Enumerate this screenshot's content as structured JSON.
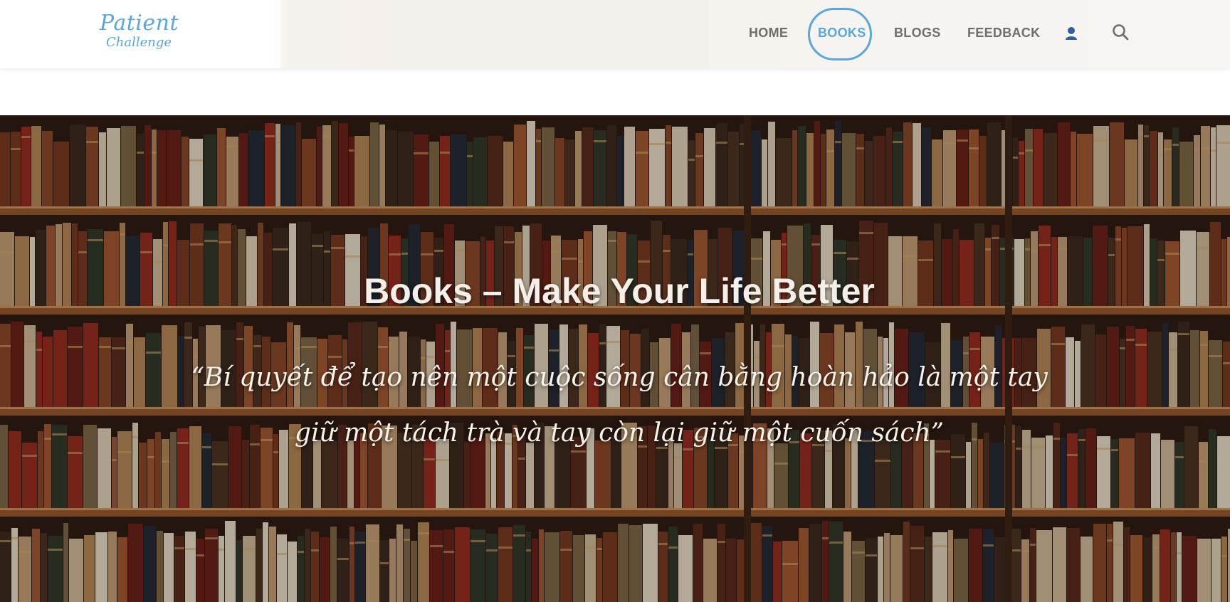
{
  "brand": {
    "line1": "Patient",
    "line2": "Challenge",
    "color": "#5aa6de"
  },
  "nav": {
    "items": [
      {
        "label": "HOME",
        "active": false
      },
      {
        "label": "BOOKS",
        "active": true
      },
      {
        "label": "BLOGS",
        "active": false
      },
      {
        "label": "FEEDBACK",
        "active": false
      }
    ],
    "user_icon": "user-icon",
    "search_icon": "search-icon"
  },
  "hero": {
    "title": "Books – Make Your Life Better",
    "quote": "“Bí quyết để tạo nên một cuộc sống cân bằng hoàn hảo là một tay giữ một tách trà và tay còn lại giữ một cuốn sách”",
    "background": "bookshelf-image"
  },
  "colors": {
    "accent": "#5aa6de",
    "nav_text": "#6e6e6e",
    "user_icon": "#2f5f9e"
  }
}
